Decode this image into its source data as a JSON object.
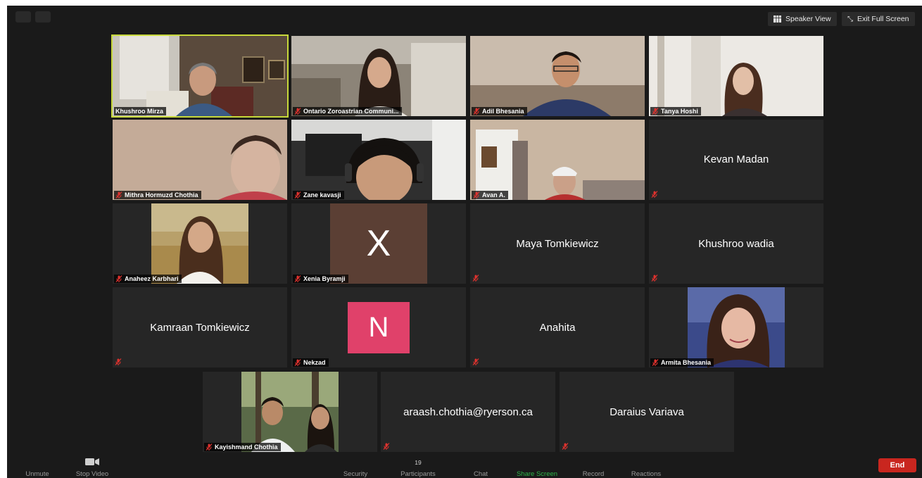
{
  "toolbar_top": {
    "speaker_view": "Speaker View",
    "exit_full_screen": "Exit Full Screen"
  },
  "tiles": [
    {
      "name": "Khushroo Mirza"
    },
    {
      "name": "Ontario Zoroastrian Communi..."
    },
    {
      "name": "Adil Bhesania"
    },
    {
      "name": "Tanya Hoshi"
    },
    {
      "name": "Mithra Hormuzd Chothia"
    },
    {
      "name": "Zane kavasji"
    },
    {
      "name": "Avan A."
    },
    {
      "name": "Kevan Madan"
    },
    {
      "name": "Anaheez Karbhari"
    },
    {
      "name": "Xenia Byramji",
      "avatar_letter": "X"
    },
    {
      "name": "Maya Tomkiewicz"
    },
    {
      "name": "Khushroo wadia"
    },
    {
      "name": "Kamraan Tomkiewicz"
    },
    {
      "name": "Nekzad",
      "avatar_letter": "N"
    },
    {
      "name": "Anahita"
    },
    {
      "name": "Armita Bhesania"
    },
    {
      "name": "Kayishmand Chothia"
    },
    {
      "name": "araash.chothia@ryerson.ca"
    },
    {
      "name": "Daraius Variava"
    }
  ],
  "bottom_toolbar": {
    "unmute": "Unmute",
    "stop_video": "Stop Video",
    "security": "Security",
    "participants": "Participants",
    "participants_count": "19",
    "chat": "Chat",
    "share_screen": "Share Screen",
    "record": "Record",
    "reactions": "Reactions",
    "end": "End"
  },
  "colors": {
    "active_speaker_border": "#c7d83a",
    "share_screen": "#2fb54a",
    "end_button": "#c9261f",
    "muted_mic": "#e0322e"
  }
}
